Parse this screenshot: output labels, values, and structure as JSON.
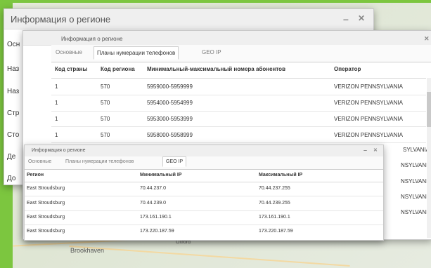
{
  "map": {
    "label_b": "Brookhaven",
    "label_o": "Oxford"
  },
  "back_window": {
    "title": "Информация о регионе",
    "fragments": [
      "Осн",
      "Наз",
      "Наз",
      "Стр",
      "Сто",
      "Де",
      "До"
    ]
  },
  "phone_window": {
    "title": "Информация о регионе",
    "tabs": [
      "Основные",
      "Планы нумерации телефонов",
      "GEO IP"
    ],
    "columns": [
      "Код страны",
      "Код региона",
      "Минимальный-максимальный номера абонентов",
      "Оператор"
    ],
    "rows": [
      [
        "1",
        "570",
        "5959000-5959999",
        "VERIZON PENNSYLVANIA"
      ],
      [
        "1",
        "570",
        "5954000-5954999",
        "VERIZON PENNSYLVANIA"
      ],
      [
        "1",
        "570",
        "5953000-5953999",
        "VERIZON PENNSYLVANIA"
      ],
      [
        "1",
        "570",
        "5958000-5958999",
        "VERIZON PENNSYLVANIA"
      ]
    ],
    "partial_operator": [
      "SYLVANIA",
      "NSYLVANIA",
      "NSYLVANIA",
      "NSYLVANIA",
      "NSYLVANIA"
    ]
  },
  "geo_window": {
    "title": "Информация о регионе",
    "tabs": [
      "Основные",
      "Планы нумерации телефонов",
      "GEO IP"
    ],
    "columns": [
      "Регион",
      "Минимальный IP",
      "Максимальный IP"
    ],
    "rows": [
      [
        "East Stroudsburg",
        "70.44.237.0",
        "70.44.237.255"
      ],
      [
        "East Stroudsburg",
        "70.44.239.0",
        "70.44.239.255"
      ],
      [
        "East Stroudsburg",
        "173.161.190.1",
        "173.161.190.1"
      ],
      [
        "East Stroudsburg",
        "173.220.187.59",
        "173.220.187.59"
      ]
    ]
  },
  "controls": {
    "minimize": "–",
    "close": "✕"
  }
}
